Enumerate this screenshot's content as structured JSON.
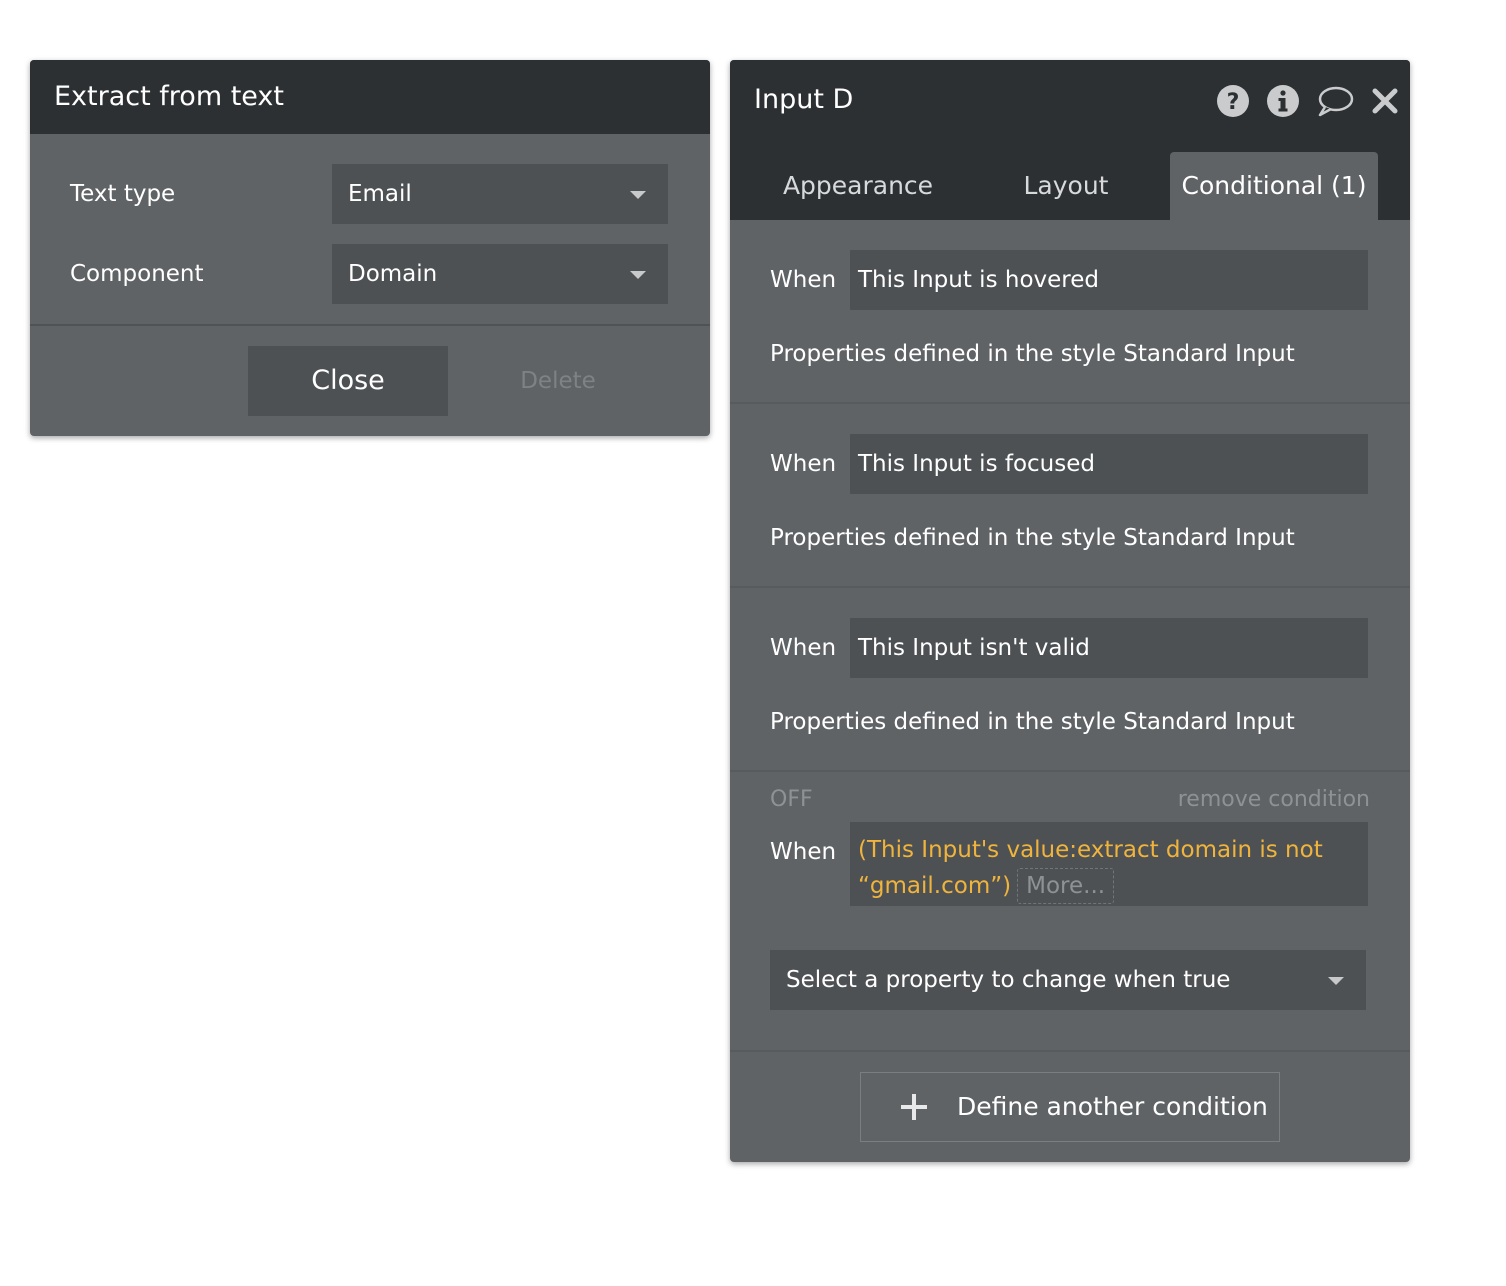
{
  "extract_panel": {
    "title": "Extract from text",
    "text_type": {
      "label": "Text type",
      "value": "Email"
    },
    "component": {
      "label": "Component",
      "value": "Domain"
    },
    "close_label": "Close",
    "delete_label": "Delete"
  },
  "input_panel": {
    "title": "Input D",
    "header_icons": [
      "help-icon",
      "info-icon",
      "comment-icon",
      "close-icon"
    ],
    "tabs": [
      {
        "label": "Appearance"
      },
      {
        "label": "Layout"
      },
      {
        "label": "Conditional (1)",
        "active": true
      }
    ],
    "conditions": [
      {
        "when_label": "When",
        "condition": "This Input is hovered",
        "properties": "Properties defined in the style Standard Input"
      },
      {
        "when_label": "When",
        "condition": "This Input is focused",
        "properties": "Properties defined in the style Standard Input"
      },
      {
        "when_label": "When",
        "condition": "This Input isn't valid",
        "properties": "Properties defined in the style Standard Input"
      }
    ],
    "custom_condition": {
      "status": "OFF",
      "remove_label": "remove condition",
      "when_label": "When",
      "expression": "(This Input's value:extract domain is not “gmail.com”)",
      "more_label": "More...",
      "property_select_placeholder": "Select a property to change when true"
    },
    "add_condition_label": "Define another condition"
  },
  "colors": {
    "header_bg": "#2c3033",
    "panel_bg": "#5f6366",
    "field_bg": "#4d5154",
    "expression_accent": "#f0b43c",
    "muted_text": "#8e9295"
  }
}
